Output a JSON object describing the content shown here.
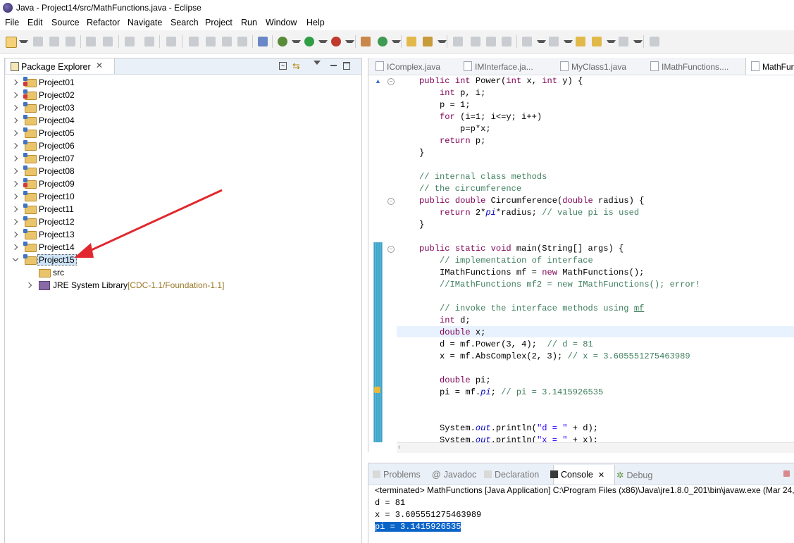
{
  "window": {
    "title": "Java - Project14/src/MathFunctions.java - Eclipse"
  },
  "menu": [
    "File",
    "Edit",
    "Source",
    "Refactor",
    "Navigate",
    "Search",
    "Project",
    "Run",
    "Window",
    "Help"
  ],
  "package_explorer": {
    "tab_label": "Package Explorer",
    "projects": [
      {
        "name": "Project01",
        "error": true
      },
      {
        "name": "Project02",
        "error": true
      },
      {
        "name": "Project03",
        "error": false
      },
      {
        "name": "Project04",
        "error": false
      },
      {
        "name": "Project05",
        "error": false
      },
      {
        "name": "Project06",
        "error": false
      },
      {
        "name": "Project07",
        "error": false
      },
      {
        "name": "Project08",
        "error": false
      },
      {
        "name": "Project09",
        "error": true
      },
      {
        "name": "Project10",
        "error": false
      },
      {
        "name": "Project11",
        "error": false
      },
      {
        "name": "Project12",
        "error": false
      },
      {
        "name": "Project13",
        "error": false
      },
      {
        "name": "Project14",
        "error": false
      },
      {
        "name": "Project15",
        "error": false,
        "expanded": true,
        "selected": true
      }
    ],
    "children": {
      "src": "src",
      "jre_label": "JRE System Library",
      "jre_detail": "[CDC-1.1/Foundation-1.1]"
    }
  },
  "editor": {
    "tabs": [
      "IComplex.java",
      "IMInterface.ja...",
      "MyClass1.java",
      "IMathFunctions....",
      "MathFun"
    ],
    "active_tab": "MathFun"
  },
  "console": {
    "tabs": [
      "Problems",
      "Javadoc",
      "Declaration",
      "Console",
      "Debug"
    ],
    "active_tab": "Console",
    "terminated": "<terminated> MathFunctions [Java Application] C:\\Program Files (x86)\\Java\\jre1.8.0_201\\bin\\javaw.exe (Mar 24, 2",
    "output": [
      "d = 81",
      "x = 3.605551275463989",
      "pi = 3.1415926535"
    ],
    "highlighted_line": "pi = 3.1415926535"
  },
  "colors": {
    "accent": "#e0282e",
    "keyword": "#7f0055",
    "comment": "#3f7f5f",
    "string": "#2a00ff",
    "selection": "#0a64c8"
  }
}
